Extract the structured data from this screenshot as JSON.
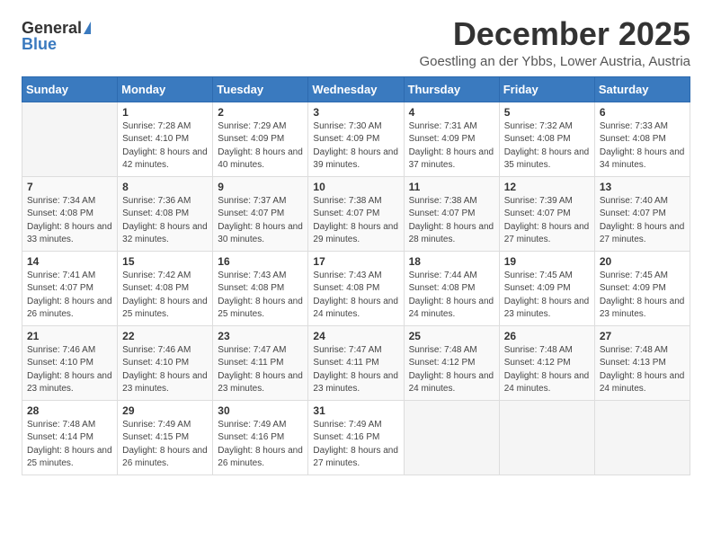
{
  "logo": {
    "general": "General",
    "blue": "Blue"
  },
  "title": "December 2025",
  "subtitle": "Goestling an der Ybbs, Lower Austria, Austria",
  "days_of_week": [
    "Sunday",
    "Monday",
    "Tuesday",
    "Wednesday",
    "Thursday",
    "Friday",
    "Saturday"
  ],
  "weeks": [
    [
      {
        "day": "",
        "sunrise": "",
        "sunset": "",
        "daylight": "",
        "empty": true
      },
      {
        "day": "1",
        "sunrise": "Sunrise: 7:28 AM",
        "sunset": "Sunset: 4:10 PM",
        "daylight": "Daylight: 8 hours and 42 minutes."
      },
      {
        "day": "2",
        "sunrise": "Sunrise: 7:29 AM",
        "sunset": "Sunset: 4:09 PM",
        "daylight": "Daylight: 8 hours and 40 minutes."
      },
      {
        "day": "3",
        "sunrise": "Sunrise: 7:30 AM",
        "sunset": "Sunset: 4:09 PM",
        "daylight": "Daylight: 8 hours and 39 minutes."
      },
      {
        "day": "4",
        "sunrise": "Sunrise: 7:31 AM",
        "sunset": "Sunset: 4:09 PM",
        "daylight": "Daylight: 8 hours and 37 minutes."
      },
      {
        "day": "5",
        "sunrise": "Sunrise: 7:32 AM",
        "sunset": "Sunset: 4:08 PM",
        "daylight": "Daylight: 8 hours and 35 minutes."
      },
      {
        "day": "6",
        "sunrise": "Sunrise: 7:33 AM",
        "sunset": "Sunset: 4:08 PM",
        "daylight": "Daylight: 8 hours and 34 minutes."
      }
    ],
    [
      {
        "day": "7",
        "sunrise": "Sunrise: 7:34 AM",
        "sunset": "Sunset: 4:08 PM",
        "daylight": "Daylight: 8 hours and 33 minutes."
      },
      {
        "day": "8",
        "sunrise": "Sunrise: 7:36 AM",
        "sunset": "Sunset: 4:08 PM",
        "daylight": "Daylight: 8 hours and 32 minutes."
      },
      {
        "day": "9",
        "sunrise": "Sunrise: 7:37 AM",
        "sunset": "Sunset: 4:07 PM",
        "daylight": "Daylight: 8 hours and 30 minutes."
      },
      {
        "day": "10",
        "sunrise": "Sunrise: 7:38 AM",
        "sunset": "Sunset: 4:07 PM",
        "daylight": "Daylight: 8 hours and 29 minutes."
      },
      {
        "day": "11",
        "sunrise": "Sunrise: 7:38 AM",
        "sunset": "Sunset: 4:07 PM",
        "daylight": "Daylight: 8 hours and 28 minutes."
      },
      {
        "day": "12",
        "sunrise": "Sunrise: 7:39 AM",
        "sunset": "Sunset: 4:07 PM",
        "daylight": "Daylight: 8 hours and 27 minutes."
      },
      {
        "day": "13",
        "sunrise": "Sunrise: 7:40 AM",
        "sunset": "Sunset: 4:07 PM",
        "daylight": "Daylight: 8 hours and 27 minutes."
      }
    ],
    [
      {
        "day": "14",
        "sunrise": "Sunrise: 7:41 AM",
        "sunset": "Sunset: 4:07 PM",
        "daylight": "Daylight: 8 hours and 26 minutes."
      },
      {
        "day": "15",
        "sunrise": "Sunrise: 7:42 AM",
        "sunset": "Sunset: 4:08 PM",
        "daylight": "Daylight: 8 hours and 25 minutes."
      },
      {
        "day": "16",
        "sunrise": "Sunrise: 7:43 AM",
        "sunset": "Sunset: 4:08 PM",
        "daylight": "Daylight: 8 hours and 25 minutes."
      },
      {
        "day": "17",
        "sunrise": "Sunrise: 7:43 AM",
        "sunset": "Sunset: 4:08 PM",
        "daylight": "Daylight: 8 hours and 24 minutes."
      },
      {
        "day": "18",
        "sunrise": "Sunrise: 7:44 AM",
        "sunset": "Sunset: 4:08 PM",
        "daylight": "Daylight: 8 hours and 24 minutes."
      },
      {
        "day": "19",
        "sunrise": "Sunrise: 7:45 AM",
        "sunset": "Sunset: 4:09 PM",
        "daylight": "Daylight: 8 hours and 23 minutes."
      },
      {
        "day": "20",
        "sunrise": "Sunrise: 7:45 AM",
        "sunset": "Sunset: 4:09 PM",
        "daylight": "Daylight: 8 hours and 23 minutes."
      }
    ],
    [
      {
        "day": "21",
        "sunrise": "Sunrise: 7:46 AM",
        "sunset": "Sunset: 4:10 PM",
        "daylight": "Daylight: 8 hours and 23 minutes."
      },
      {
        "day": "22",
        "sunrise": "Sunrise: 7:46 AM",
        "sunset": "Sunset: 4:10 PM",
        "daylight": "Daylight: 8 hours and 23 minutes."
      },
      {
        "day": "23",
        "sunrise": "Sunrise: 7:47 AM",
        "sunset": "Sunset: 4:11 PM",
        "daylight": "Daylight: 8 hours and 23 minutes."
      },
      {
        "day": "24",
        "sunrise": "Sunrise: 7:47 AM",
        "sunset": "Sunset: 4:11 PM",
        "daylight": "Daylight: 8 hours and 23 minutes."
      },
      {
        "day": "25",
        "sunrise": "Sunrise: 7:48 AM",
        "sunset": "Sunset: 4:12 PM",
        "daylight": "Daylight: 8 hours and 24 minutes."
      },
      {
        "day": "26",
        "sunrise": "Sunrise: 7:48 AM",
        "sunset": "Sunset: 4:12 PM",
        "daylight": "Daylight: 8 hours and 24 minutes."
      },
      {
        "day": "27",
        "sunrise": "Sunrise: 7:48 AM",
        "sunset": "Sunset: 4:13 PM",
        "daylight": "Daylight: 8 hours and 24 minutes."
      }
    ],
    [
      {
        "day": "28",
        "sunrise": "Sunrise: 7:48 AM",
        "sunset": "Sunset: 4:14 PM",
        "daylight": "Daylight: 8 hours and 25 minutes."
      },
      {
        "day": "29",
        "sunrise": "Sunrise: 7:49 AM",
        "sunset": "Sunset: 4:15 PM",
        "daylight": "Daylight: 8 hours and 26 minutes."
      },
      {
        "day": "30",
        "sunrise": "Sunrise: 7:49 AM",
        "sunset": "Sunset: 4:16 PM",
        "daylight": "Daylight: 8 hours and 26 minutes."
      },
      {
        "day": "31",
        "sunrise": "Sunrise: 7:49 AM",
        "sunset": "Sunset: 4:16 PM",
        "daylight": "Daylight: 8 hours and 27 minutes."
      },
      {
        "day": "",
        "sunrise": "",
        "sunset": "",
        "daylight": "",
        "empty": true
      },
      {
        "day": "",
        "sunrise": "",
        "sunset": "",
        "daylight": "",
        "empty": true
      },
      {
        "day": "",
        "sunrise": "",
        "sunset": "",
        "daylight": "",
        "empty": true
      }
    ]
  ]
}
